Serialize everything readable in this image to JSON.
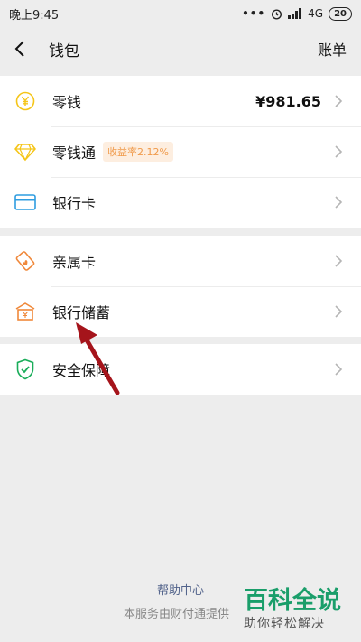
{
  "status": {
    "time": "晚上9:45",
    "network": "4G",
    "battery": "20"
  },
  "header": {
    "title": "钱包",
    "right": "账单"
  },
  "group1": [
    {
      "label": "零钱",
      "value": "¥981.65",
      "icon": "yuan-circle-icon"
    },
    {
      "label": "零钱通",
      "badge": "收益率2.12%",
      "icon": "diamond-icon"
    },
    {
      "label": "银行卡",
      "icon": "card-icon"
    }
  ],
  "group2": [
    {
      "label": "亲属卡",
      "icon": "family-card-icon"
    },
    {
      "label": "银行储蓄",
      "icon": "bank-deposit-icon"
    }
  ],
  "group3": [
    {
      "label": "安全保障",
      "icon": "shield-icon"
    }
  ],
  "footer": {
    "help": "帮助中心",
    "note": "本服务由财付通提供"
  },
  "watermark": {
    "title": "百科全说",
    "subtitle": "助你轻松解决"
  },
  "colors": {
    "accent_yellow": "#f5c518",
    "blue": "#2f9de0",
    "orange": "#f0883a",
    "green": "#1aad5a"
  }
}
